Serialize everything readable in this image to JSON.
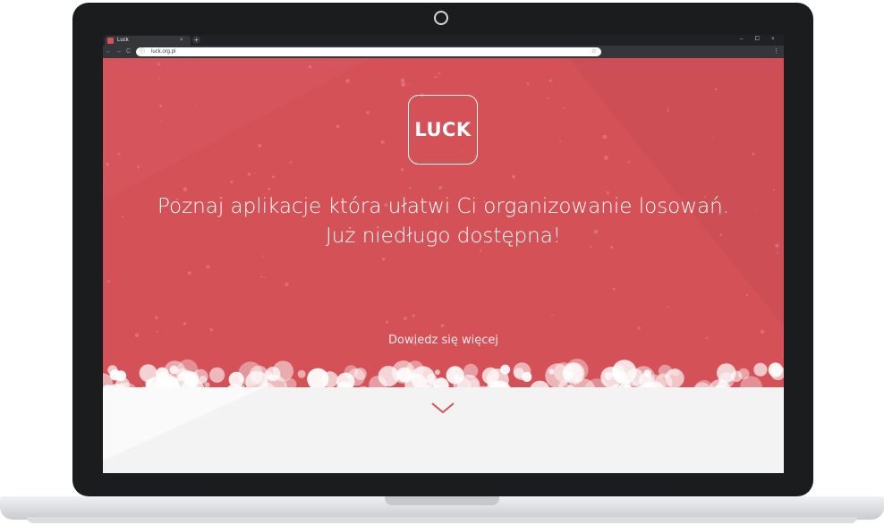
{
  "browser": {
    "tab_title": "Luck",
    "tab_close": "×",
    "new_tab": "+",
    "url": "luck.org.pl",
    "window_controls": {
      "minimize": "–",
      "maximize": "⧠",
      "close": "×"
    },
    "nav": {
      "back": "←",
      "forward": "→",
      "reload": "C"
    },
    "icons": [
      "info-icon",
      "star-icon",
      "menu-icon"
    ]
  },
  "page": {
    "logo_text": "LUCK",
    "headline_line1": "Poznaj aplikacje która ułatwi Ci organizowanie losowań.",
    "headline_line2": "Już niedługo dostępna!",
    "learn_more": "Dowiedz się więcej"
  },
  "colors": {
    "accent": "#d5525a",
    "foam": "#f3f3f4"
  }
}
